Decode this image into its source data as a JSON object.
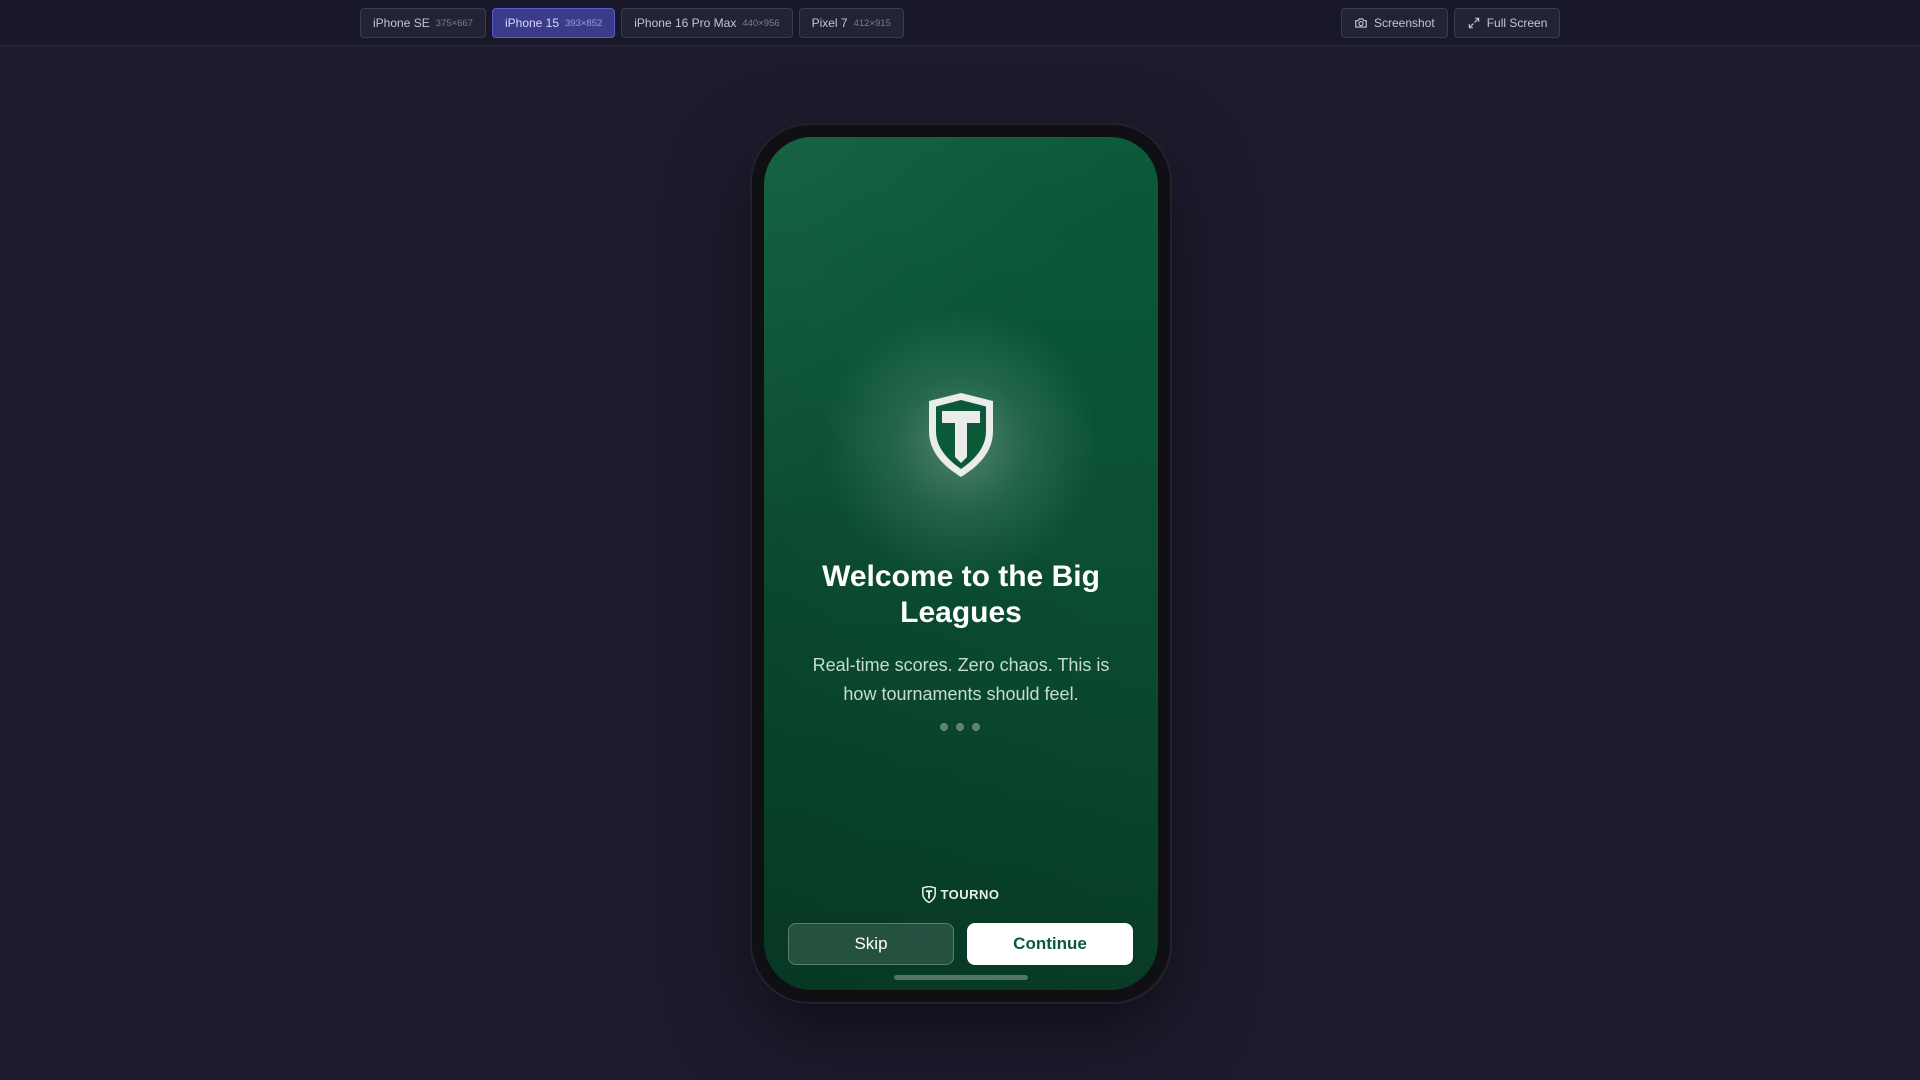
{
  "toolbar": {
    "devices": [
      {
        "name": "iPhone SE",
        "dims": "375×667",
        "active": false
      },
      {
        "name": "iPhone 15",
        "dims": "393×852",
        "active": true
      },
      {
        "name": "iPhone 16 Pro Max",
        "dims": "440×956",
        "active": false
      },
      {
        "name": "Pixel 7",
        "dims": "412×915",
        "active": false
      }
    ],
    "screenshot_label": "Screenshot",
    "fullscreen_label": "Full Screen"
  },
  "onboarding": {
    "title": "Welcome to the Big Leagues",
    "subtitle": "Real-time scores. Zero chaos. This is how tournaments should feel.",
    "page_dots": 3,
    "brand_name": "TOURNO",
    "skip_label": "Skip",
    "continue_label": "Continue"
  },
  "colors": {
    "page_background": "#1c1c2e",
    "screen_green": "#0a5a39",
    "active_tab": "#3b3b8a",
    "continue_text": "#0b5a37"
  },
  "icons": {
    "screenshot": "camera-icon",
    "fullscreen": "expand-icon",
    "logo": "shield-t-logo-icon"
  }
}
